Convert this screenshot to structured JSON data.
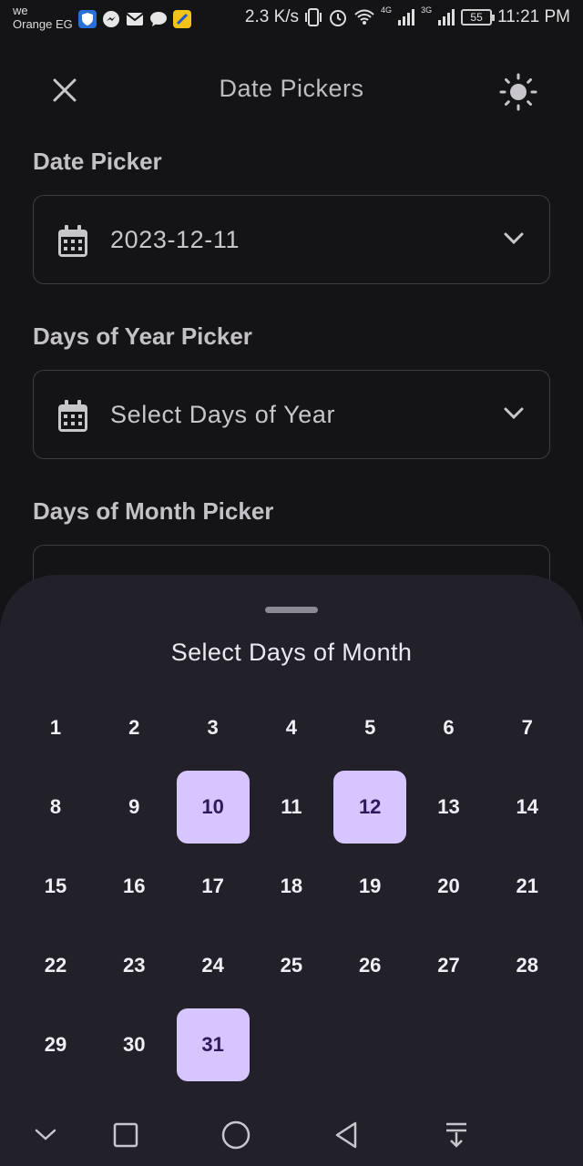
{
  "status_bar": {
    "carrier_line1": "we",
    "carrier_line2": "Orange EG",
    "net_speed": "2.3 K/s",
    "net1": "4G",
    "net2": "3G",
    "battery": "55",
    "time": "11:21 PM"
  },
  "app_bar": {
    "title": "Date Pickers"
  },
  "date_picker": {
    "label": "Date Picker",
    "value": "2023-12-11"
  },
  "days_of_year_picker": {
    "label": "Days of Year Picker",
    "placeholder": "Select Days of Year"
  },
  "days_of_month_picker": {
    "label": "Days of Month Picker"
  },
  "sheet": {
    "title": "Select Days of Month",
    "days": [
      "1",
      "2",
      "3",
      "4",
      "5",
      "6",
      "7",
      "8",
      "9",
      "10",
      "11",
      "12",
      "13",
      "14",
      "15",
      "16",
      "17",
      "18",
      "19",
      "20",
      "21",
      "22",
      "23",
      "24",
      "25",
      "26",
      "27",
      "28",
      "29",
      "30",
      "31"
    ],
    "selected": [
      "10",
      "12",
      "31"
    ],
    "accent_color": "#d7c5ff"
  },
  "nav_bar": {
    "icons": [
      "chevron-down-icon",
      "recents-square-icon",
      "home-circle-icon",
      "back-triangle-icon",
      "notification-pull-icon"
    ]
  }
}
